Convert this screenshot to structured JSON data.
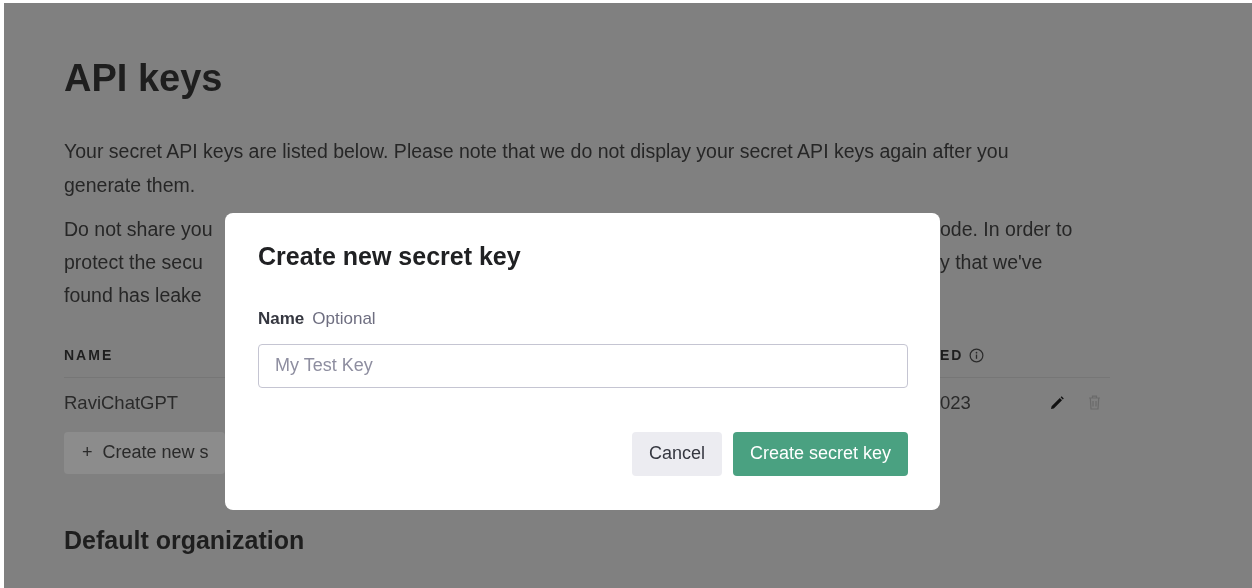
{
  "page": {
    "title": "API keys",
    "intro": "Your secret API keys are listed below. Please note that we do not display your secret API keys again after you generate them.",
    "notice_lines": [
      {
        "left": "Do not share you",
        "right": "ode. In order to"
      },
      {
        "left": "protect the secu",
        "right": "y that we've"
      },
      {
        "left": "found has leake"
      }
    ],
    "table": {
      "columns": [
        {
          "label": "NAME"
        },
        {
          "label": "ED",
          "info_icon": true
        }
      ],
      "rows": [
        {
          "name": "RaviChatGPT",
          "column_2": "023"
        }
      ]
    },
    "create_button": {
      "icon": "+",
      "label": "Create new s"
    },
    "section_title": "Default organization"
  },
  "dialog": {
    "title": "Create new secret key",
    "field": {
      "label": "Name",
      "hint": "Optional",
      "placeholder": "My Test Key"
    },
    "buttons": [
      {
        "label": "Cancel",
        "kind": "secondary"
      },
      {
        "label": "Create secret key",
        "kind": "primary"
      }
    ]
  }
}
